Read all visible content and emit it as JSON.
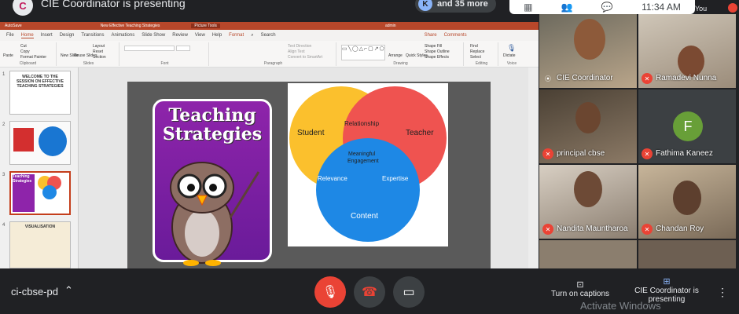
{
  "top": {
    "presenter_initial": "C",
    "presenting_text": "CIE Coordinator is presenting",
    "more_initial": "K",
    "more_text": "and 35 more",
    "clock": "11:34 AM",
    "you_label": "You"
  },
  "ppt": {
    "autosave": "AutoSave",
    "doc_title": "New Effective Teaching Strategies",
    "picture_tools": "Picture Tools",
    "user": "admin",
    "tabs": [
      "File",
      "Home",
      "Insert",
      "Design",
      "Transitions",
      "Animations",
      "Slide Show",
      "Review",
      "View",
      "Help",
      "Format",
      "Search"
    ],
    "share": "Share",
    "comments": "Comments",
    "groups": {
      "clipboard": "Clipboard",
      "slides": "Slides",
      "font": "Font",
      "paragraph": "Paragraph",
      "drawing": "Drawing",
      "editing": "Editing",
      "voice": "Voice"
    },
    "buttons": {
      "paste": "Paste",
      "cut": "Cut",
      "copy": "Copy",
      "format_painter": "Format Painter",
      "new_slide": "New Slide",
      "reuse_slides": "Reuse Slides",
      "layout": "Layout",
      "reset": "Reset",
      "section": "Section",
      "text_direction": "Text Direction",
      "align_text": "Align Text",
      "convert_smartart": "Convert to SmartArt",
      "arrange": "Arrange",
      "quick_styles": "Quick Styles",
      "shape_fill": "Shape Fill",
      "shape_outline": "Shape Outline",
      "shape_effects": "Shape Effects",
      "find": "Find",
      "replace": "Replace",
      "select": "Select",
      "dictate": "Dictate"
    },
    "thumbs": [
      {
        "num": "1",
        "text": "WELCOME TO THE SESSION ON EFFECTIVE TEACHING STRATEGIES"
      },
      {
        "num": "2",
        "text": ""
      },
      {
        "num": "3",
        "text": "Teaching Strategies"
      },
      {
        "num": "4",
        "text": "VISUALISATION"
      }
    ],
    "slide": {
      "card_title_1": "Teaching",
      "card_title_2": "Strategies",
      "venn": {
        "student": "Student",
        "teacher": "Teacher",
        "content": "Content",
        "relationship": "Relationship",
        "relevance": "Relevance",
        "expertise": "Expertise",
        "center_1": "Meaningful",
        "center_2": "Engagement",
        "color_student": "#fbc02d",
        "color_teacher": "#ef5350",
        "color_content": "#1e88e5",
        "color_relationship": "#f57c00",
        "color_relevance": "#2e7d32",
        "color_expertise": "#5e35b1"
      }
    }
  },
  "tiles": [
    {
      "name": "CIE Coordinator",
      "muted": false
    },
    {
      "name": "Ramadevi Nunna",
      "muted": true
    },
    {
      "name": "principal cbse",
      "muted": true
    },
    {
      "name": "Fathima Kaneez",
      "muted": true,
      "initial": "F",
      "color": "#689f38"
    },
    {
      "name": "Nandita Mauntharoa",
      "muted": true
    },
    {
      "name": "Chandan Roy",
      "muted": true
    }
  ],
  "bottom": {
    "meet_code": "ci-cbse-pd",
    "captions": "Turn on captions",
    "presenting": "CIE Coordinator is presenting",
    "activate": "Activate Windows"
  }
}
